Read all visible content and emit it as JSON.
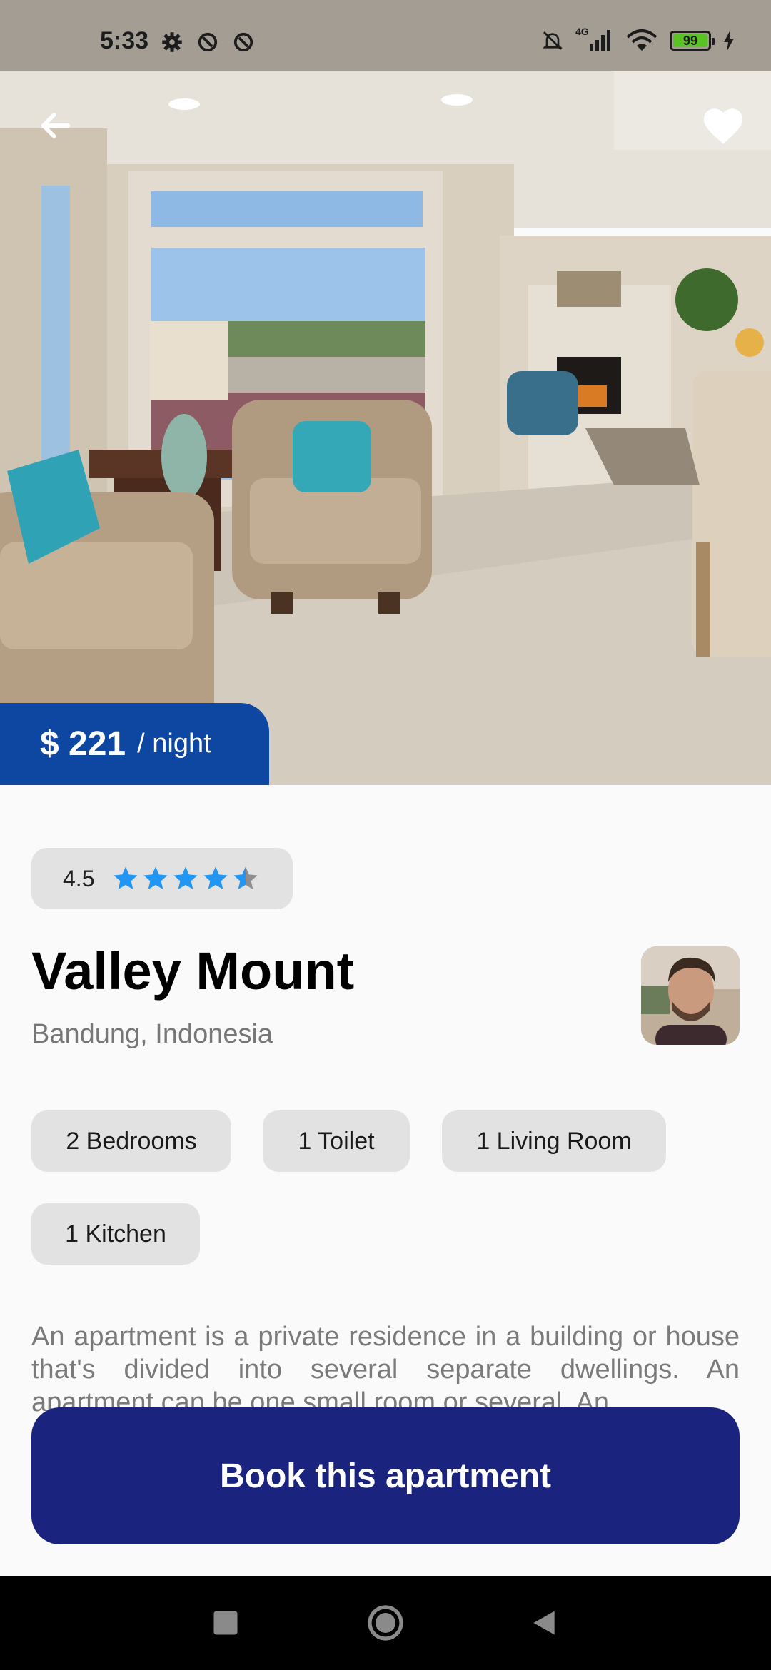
{
  "status_bar": {
    "time": "5:33",
    "network": "4G",
    "battery": "99",
    "icons": [
      "gear-icon",
      "vpn-icon",
      "data-saver-icon",
      "mute-icon",
      "signal-icon",
      "wifi-icon",
      "battery-icon",
      "charging-icon"
    ]
  },
  "listing": {
    "price": "$ 221",
    "price_unit": "/ night",
    "rating": "4.5",
    "rating_value": 4.5,
    "rating_max": 5,
    "name": "Valley Mount",
    "location": "Bandung, Indonesia",
    "features": [
      "2 Bedrooms",
      "1 Toilet",
      "1 Living Room",
      "1 Kitchen"
    ],
    "description": "An apartment is a private residence in a building or house that's divided into several separate dwellings. An apartment can be one small room or several. An"
  },
  "actions": {
    "book_label": "Book this apartment"
  },
  "colors": {
    "price_tag": "#0d47a1",
    "book_button": "#1a237e",
    "star": "#2196f3",
    "chip_bg": "#e2e2e2"
  }
}
